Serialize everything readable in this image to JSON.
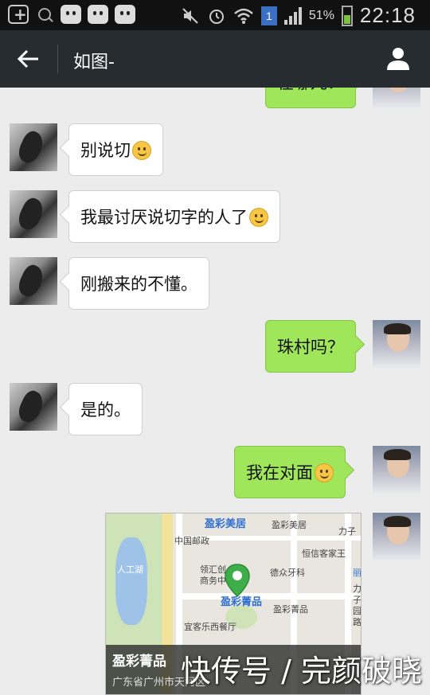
{
  "status_bar": {
    "battery_percent": "51%",
    "time": "22:18",
    "sim_label": "1",
    "icons": [
      "add-icon",
      "search-icon",
      "app-icon",
      "app-icon",
      "app-icon",
      "mute-icon",
      "alarm-icon",
      "wifi-icon",
      "sim-icon",
      "signal-icon",
      "battery-icon"
    ]
  },
  "header": {
    "title": "如图-",
    "back_icon": "back-arrow-icon",
    "profile_icon": "profile-icon"
  },
  "messages": [
    {
      "sender": "self",
      "text": "在哪儿？",
      "partial": true
    },
    {
      "sender": "peer",
      "text": "别说切",
      "emoji": "shy-emoji"
    },
    {
      "sender": "peer",
      "text": "我最讨厌说切字的人了",
      "emoji": "smile-emoji"
    },
    {
      "sender": "peer",
      "text": "刚搬来的不懂。"
    },
    {
      "sender": "self",
      "text": "珠村吗？"
    },
    {
      "sender": "peer",
      "text": "是的。"
    },
    {
      "sender": "self",
      "text": "我在对面",
      "emoji": "laugh-cry-emoji"
    },
    {
      "sender": "self",
      "type": "location"
    }
  ],
  "location_card": {
    "name": "盈彩菁品",
    "address": "广东省广州市天河区",
    "map_labels": [
      "盈彩美居",
      "盈彩美居",
      "力子",
      "中国邮政",
      "恒信客家王",
      "人工湖",
      "领汇创",
      "商务中",
      "德众牙科",
      "盈彩菁品",
      "盈彩菁品",
      "宜客乐西餐厅",
      "丽",
      "力",
      "子",
      "园",
      "路"
    ]
  },
  "watermark": "快传号 / 完颜破晓",
  "colors": {
    "title_bar": "#272c31",
    "self_bubble": "#9fe65a",
    "peer_bubble": "#ffffff",
    "chat_bg": "#ececec",
    "pin": "#3dae4a"
  }
}
